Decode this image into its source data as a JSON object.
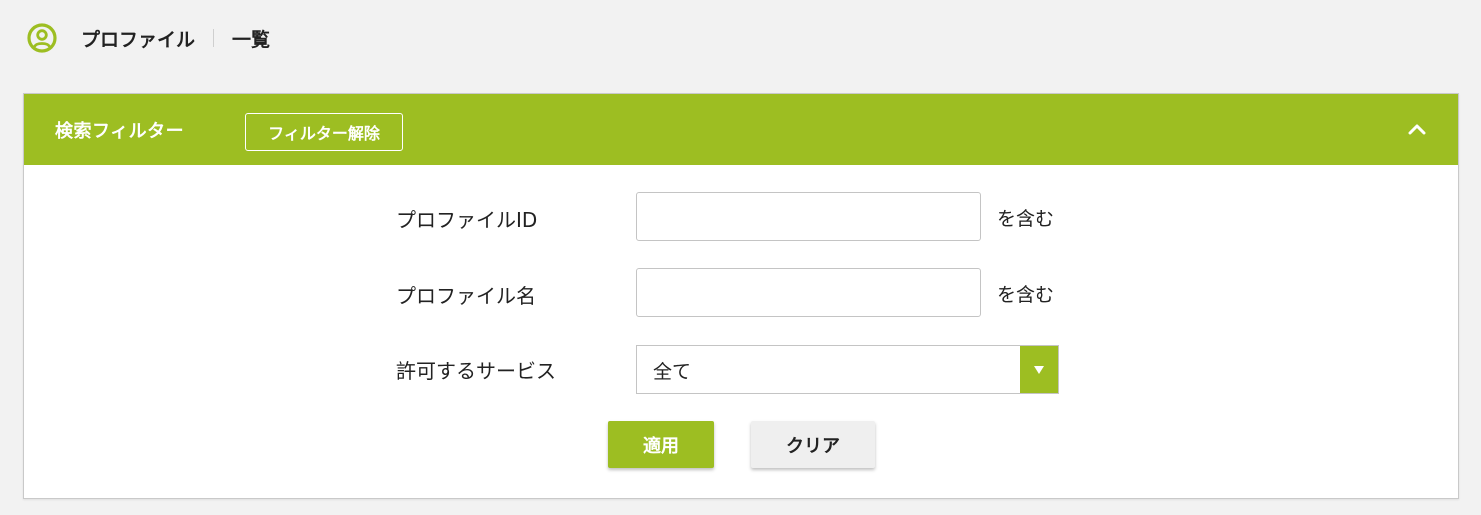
{
  "header": {
    "title": "プロファイル",
    "subtitle": "一覧",
    "icon": "user-circle-icon",
    "icon_color": "#9dbe22"
  },
  "filter_panel": {
    "title": "検索フィルター",
    "clear_filter_label": "フィルター解除",
    "collapse_icon": "chevron-up-icon",
    "header_color": "#9dbe22",
    "fields": {
      "profile_id": {
        "label": "プロファイルID",
        "value": "",
        "placeholder": "",
        "suffix": "を含む"
      },
      "profile_name": {
        "label": "プロファイル名",
        "value": "",
        "placeholder": "",
        "suffix": "を含む"
      },
      "allowed_services": {
        "label": "許可するサービス",
        "selected": "全て",
        "arrow_icon": "triangle-down-icon"
      }
    },
    "apply_label": "適用",
    "clear_label": "クリア"
  }
}
